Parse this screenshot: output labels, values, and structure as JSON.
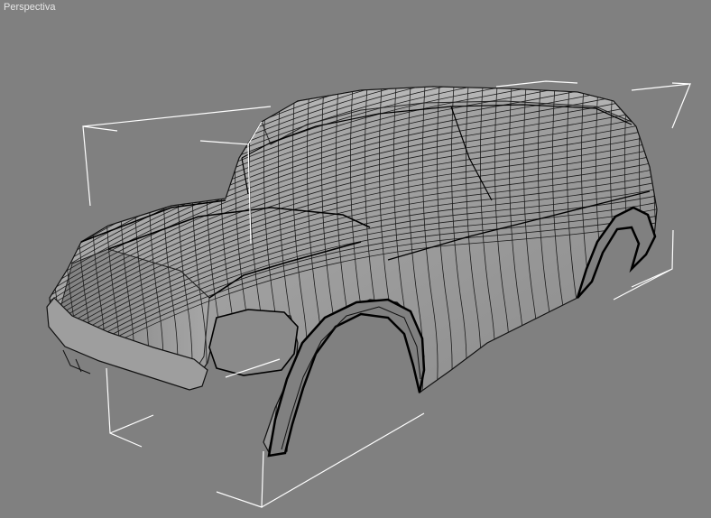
{
  "viewport": {
    "label": "Perspectiva",
    "background_color": "#808080"
  },
  "scene": {
    "object": "car-body-wireframe-mesh",
    "selection": "bounding-box-brackets",
    "mesh_fill": "#9a9a9a",
    "wire_color": "#1a1a1a",
    "bracket_color": "#ffffff"
  }
}
